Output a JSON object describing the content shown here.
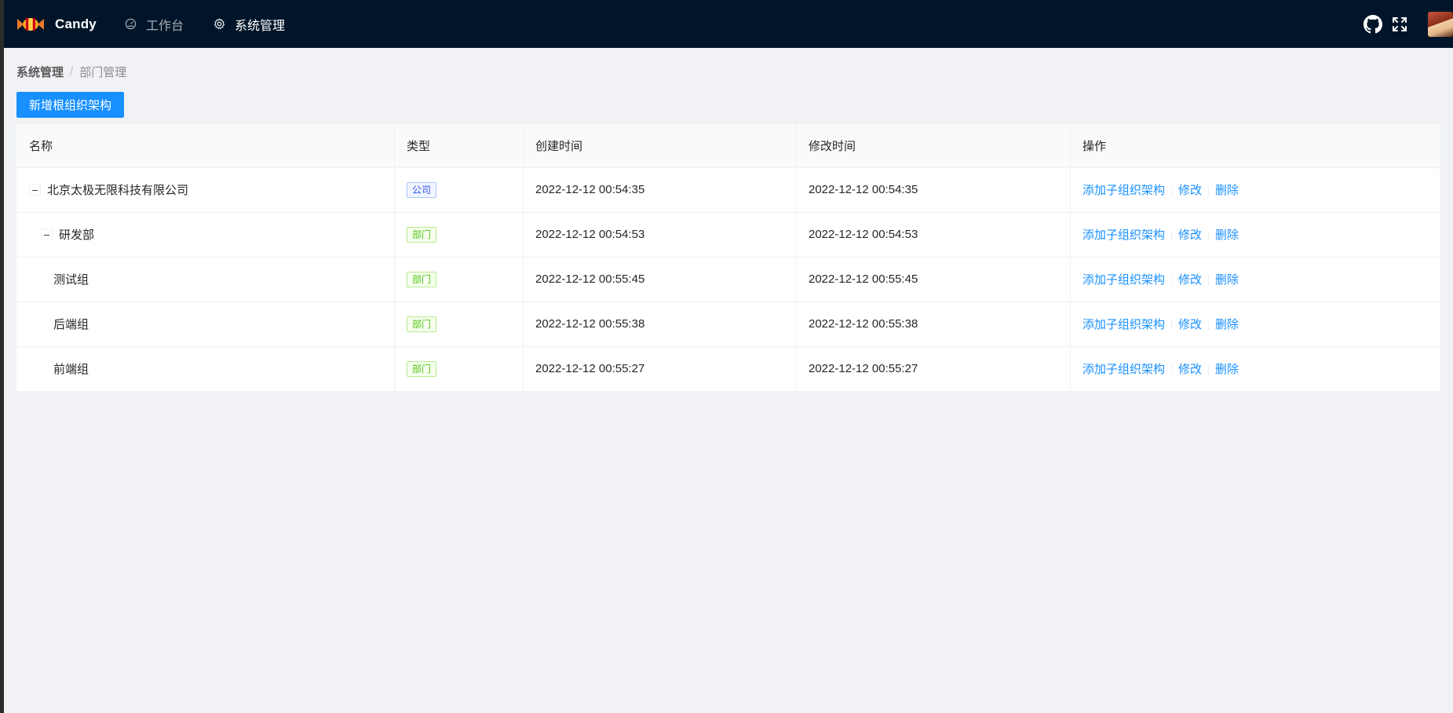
{
  "app": {
    "brand": "Candy",
    "nav": [
      {
        "label": "工作台",
        "icon": "dashboard-icon"
      },
      {
        "label": "系统管理",
        "icon": "gear-icon"
      }
    ],
    "topbar_icons": [
      "github-icon",
      "fullscreen-icon",
      "avatar"
    ]
  },
  "breadcrumb": {
    "parent": "系统管理",
    "separator": "/",
    "current": "部门管理"
  },
  "toolbar": {
    "add_root_label": "新增根组织架构"
  },
  "table": {
    "columns": [
      "名称",
      "类型",
      "创建时间",
      "修改时间",
      "操作"
    ],
    "rows": [
      {
        "name": "北京太极无限科技有限公司",
        "level": 0,
        "expander": "–",
        "type": "公司",
        "created": "2022-12-12 00:54:35",
        "modified": "2022-12-12 00:54:35"
      },
      {
        "name": "研发部",
        "level": 1,
        "expander": "–",
        "type": "部门",
        "created": "2022-12-12 00:54:53",
        "modified": "2022-12-12 00:54:53"
      },
      {
        "name": "测试组",
        "level": 2,
        "expander": "",
        "type": "部门",
        "created": "2022-12-12 00:55:45",
        "modified": "2022-12-12 00:55:45"
      },
      {
        "name": "后端组",
        "level": 2,
        "expander": "",
        "type": "部门",
        "created": "2022-12-12 00:55:38",
        "modified": "2022-12-12 00:55:38"
      },
      {
        "name": "前端组",
        "level": 2,
        "expander": "",
        "type": "部门",
        "created": "2022-12-12 00:55:27",
        "modified": "2022-12-12 00:55:27"
      }
    ],
    "actions": {
      "add_child": "添加子组织架构",
      "edit": "修改",
      "delete": "删除"
    }
  },
  "colors": {
    "topbar": "#001529",
    "primary": "#1890ff",
    "page_bg": "#f0f2f5",
    "tag_company": "#2f54eb",
    "tag_dept": "#52c41a"
  }
}
